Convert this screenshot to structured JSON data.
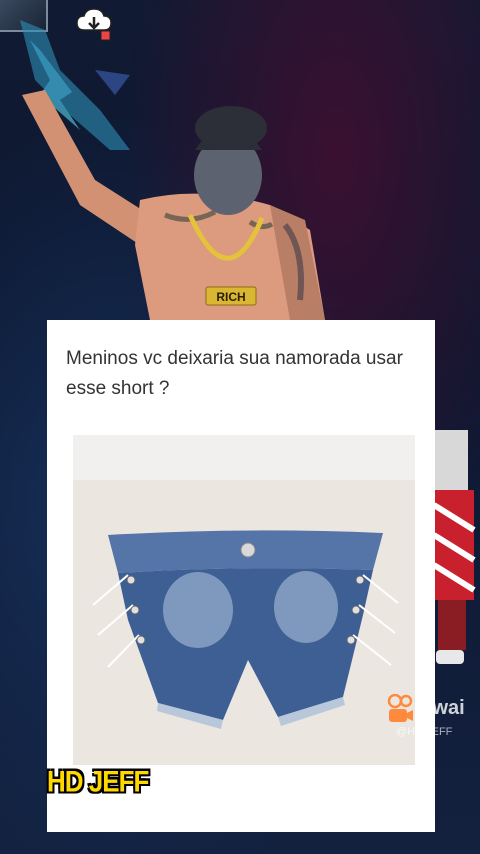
{
  "post": {
    "text": "Meninos vc deixaria sua namorada usar esse short ?"
  },
  "character": {
    "chain_pendant": "RICH"
  },
  "watermarks": {
    "hd_label": "HD JEFF",
    "kwai_label": "Kwai",
    "kwai_user": "@HD JEFF"
  },
  "icons": {
    "cloud": "cloud-download-icon",
    "kwai": "kwai-camera-icon"
  },
  "colors": {
    "card_background": "#ffffff",
    "hd_label": "#ffd800",
    "denim": "#3d5f94"
  }
}
